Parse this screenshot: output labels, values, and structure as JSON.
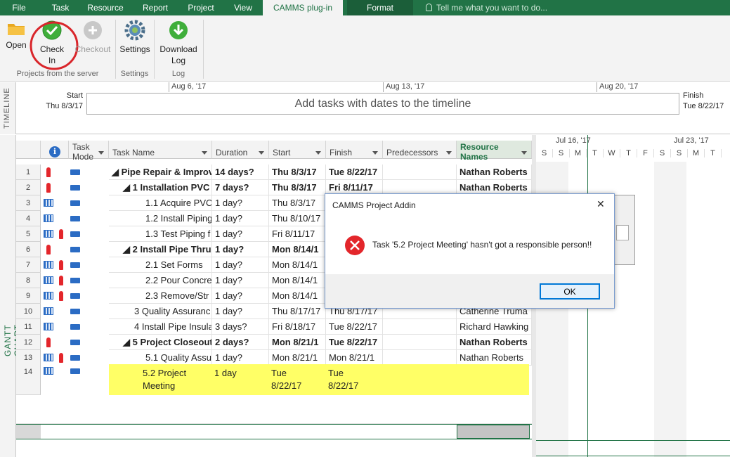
{
  "menu": {
    "tabs": [
      "File",
      "Task",
      "Resource",
      "Report",
      "Project",
      "View",
      "CAMMS plug-in",
      "Format"
    ],
    "tell_me": "Tell me what you want to do..."
  },
  "ribbon": {
    "open": "Open",
    "check_in_1": "Check",
    "check_in_2": "In",
    "checkout": "Checkout",
    "settings": "Settings",
    "download_1": "Download",
    "download_2": "Log",
    "groups": {
      "projects": "Projects from the server",
      "settings": "Settings",
      "log": "Log"
    }
  },
  "timeline": {
    "side_label": "TIMELINE",
    "start_label": "Start",
    "start_date": "Thu 8/3/17",
    "finish_label": "Finish",
    "finish_date": "Tue 8/22/17",
    "ticks": [
      "Aug 6, '17",
      "Aug 13, '17",
      "Aug 20, '17"
    ],
    "placeholder": "Add tasks with dates to the timeline"
  },
  "gantt": {
    "side_label": "GANTT CHART",
    "headers": {
      "info": "i",
      "mode_1": "Task",
      "mode_2": "Mode",
      "name": "Task Name",
      "duration": "Duration",
      "start": "Start",
      "finish": "Finish",
      "pred": "Predecessors",
      "res_1": "Resource",
      "res_2": "Names"
    },
    "chart_weeks": [
      "Jul 16, '17",
      "Jul 23, '17"
    ],
    "chart_days": [
      "S",
      "S",
      "M",
      "T",
      "W",
      "T",
      "F",
      "S",
      "S",
      "M",
      "T"
    ],
    "rows": [
      {
        "n": "1",
        "name": "◢ Pipe Repair & Improv",
        "dur": "14 days?",
        "start": "Thu 8/3/17",
        "finish": "Tue 8/22/17",
        "res": "Nathan Roberts",
        "bold": true
      },
      {
        "n": "2",
        "name": "◢ 1 Installation PVC",
        "dur": "7 days?",
        "start": "Thu 8/3/17",
        "finish": "Fri 8/11/17",
        "res": "Nathan Roberts",
        "bold": true
      },
      {
        "n": "3",
        "name": "1.1 Acquire PVC",
        "dur": "1 day?",
        "start": "Thu 8/3/17",
        "finish": "",
        "res": ""
      },
      {
        "n": "4",
        "name": "1.2 Install Piping",
        "dur": "1 day?",
        "start": "Thu 8/10/17",
        "finish": "",
        "res": ""
      },
      {
        "n": "5",
        "name": "1.3 Test Piping f",
        "dur": "1 day?",
        "start": "Fri 8/11/17",
        "finish": "",
        "res": ""
      },
      {
        "n": "6",
        "name": "◢ 2 Install Pipe Thru",
        "dur": "1 day?",
        "start": "Mon 8/14/1",
        "finish": "",
        "res": "",
        "bold": true
      },
      {
        "n": "7",
        "name": "2.1 Set Forms",
        "dur": "1 day?",
        "start": "Mon 8/14/1",
        "finish": "",
        "res": ""
      },
      {
        "n": "8",
        "name": "2.2 Pour Concre",
        "dur": "1 day?",
        "start": "Mon 8/14/1",
        "finish": "",
        "res": ""
      },
      {
        "n": "9",
        "name": "2.3 Remove/Str",
        "dur": "1 day?",
        "start": "Mon 8/14/1",
        "finish": "",
        "res": ""
      },
      {
        "n": "10",
        "name": "3 Quality Assuranc",
        "dur": "1 day?",
        "start": "Thu 8/17/17",
        "finish": "Thu 8/17/17",
        "res": "Catherine Truma"
      },
      {
        "n": "11",
        "name": "4 Install Pipe Insula",
        "dur": "3 days?",
        "start": "Fri 8/18/17",
        "finish": "Tue 8/22/17",
        "res": "Richard Hawking"
      },
      {
        "n": "12",
        "name": "◢ 5 Project Closeout",
        "dur": "2 days?",
        "start": "Mon 8/21/1",
        "finish": "Tue 8/22/17",
        "res": "Nathan Roberts",
        "bold": true
      },
      {
        "n": "13",
        "name": "5.1 Quality Assu",
        "dur": "1 day?",
        "start": "Mon 8/21/1",
        "finish": "Mon 8/21/1",
        "res": "Nathan Roberts"
      }
    ],
    "row14": {
      "n": "14",
      "name_1": "5.2 Project",
      "name_2": "Meeting",
      "dur": "1 day",
      "start_1": "Tue",
      "start_2": "8/22/17",
      "finish_1": "Tue",
      "finish_2": "8/22/17"
    }
  },
  "dialog": {
    "title": "CAMMS Project Addin",
    "message": "Task '5.2 Project Meeting' hasn't got a responsible person!!",
    "ok": "OK",
    "close": "✕"
  },
  "colors": {
    "accent": "#217346",
    "highlight": "#ffff66",
    "error": "#e3262b",
    "annotation": "#d9262b"
  }
}
